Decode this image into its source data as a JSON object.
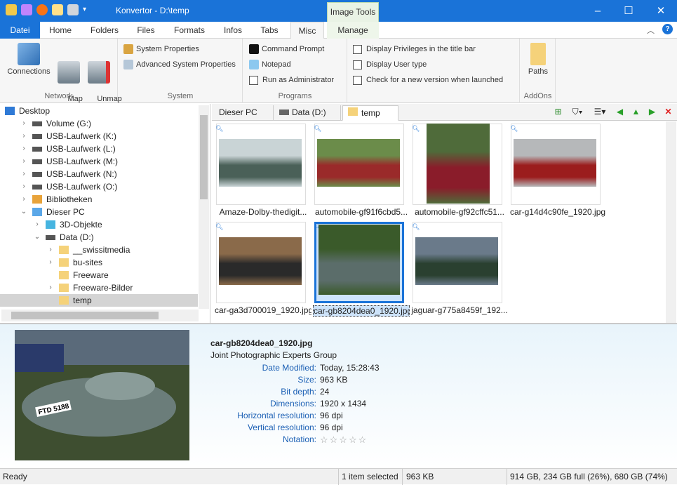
{
  "window": {
    "title": "Konvertor - D:\\temp",
    "context_tab": "Image Tools"
  },
  "tabs": [
    {
      "label": "Datei"
    },
    {
      "label": "Home"
    },
    {
      "label": "Folders"
    },
    {
      "label": "Files"
    },
    {
      "label": "Formats"
    },
    {
      "label": "Infos"
    },
    {
      "label": "Tabs"
    },
    {
      "label": "Misc"
    },
    {
      "label": "Manage"
    }
  ],
  "ribbon": {
    "network": {
      "label": "Network",
      "connections": "Connections",
      "map_drive": "Map\nDrive",
      "unmap_drive": "Unmap\nDrive"
    },
    "system": {
      "label": "System",
      "sys_props": "System Properties",
      "adv_sys_props": "Advanced System Properties"
    },
    "programs": {
      "label": "Programs",
      "cmd": "Command Prompt",
      "notepad": "Notepad",
      "run_admin": "Run as Administrator"
    },
    "options": {
      "privileges": "Display Privileges in the title bar",
      "user_type": "Display User type",
      "check_version": "Check for a new version when launched"
    },
    "addons": {
      "label": "AddOns",
      "paths": "Paths"
    }
  },
  "tree": [
    {
      "label": "Desktop",
      "level": 0,
      "arrow": ""
    },
    {
      "label": "Volume (G:)",
      "level": 1,
      "arrow": ">"
    },
    {
      "label": "USB-Laufwerk (K:)",
      "level": 1,
      "arrow": ">"
    },
    {
      "label": "USB-Laufwerk (L:)",
      "level": 1,
      "arrow": ">"
    },
    {
      "label": "USB-Laufwerk (M:)",
      "level": 1,
      "arrow": ">"
    },
    {
      "label": "USB-Laufwerk (N:)",
      "level": 1,
      "arrow": ">"
    },
    {
      "label": "USB-Laufwerk (O:)",
      "level": 1,
      "arrow": ">"
    },
    {
      "label": "Bibliotheken",
      "level": 1,
      "arrow": ">"
    },
    {
      "label": "Dieser PC",
      "level": 1,
      "arrow": "v"
    },
    {
      "label": "3D-Objekte",
      "level": 2,
      "arrow": ">"
    },
    {
      "label": "Data (D:)",
      "level": 2,
      "arrow": "v"
    },
    {
      "label": "__swissitmedia",
      "level": 3,
      "arrow": ">"
    },
    {
      "label": "bu-sites",
      "level": 3,
      "arrow": ">"
    },
    {
      "label": "Freeware",
      "level": 3,
      "arrow": ""
    },
    {
      "label": "Freeware-Bilder",
      "level": 3,
      "arrow": ">"
    },
    {
      "label": "temp",
      "level": 3,
      "arrow": "",
      "selected": true
    }
  ],
  "path_tabs": [
    {
      "label": "Dieser PC"
    },
    {
      "label": "Data (D:)"
    },
    {
      "label": "temp"
    }
  ],
  "files": [
    {
      "name": "Amaze-Dolby-thedigit...",
      "c1": "#4a6058",
      "c2": "#c9d4d6"
    },
    {
      "name": "automobile-gf91f6cbd5...",
      "c1": "#9a2a2a",
      "c2": "#6b8c4a"
    },
    {
      "name": "automobile-gf92cffc51...",
      "c1": "#8a1c2a",
      "c2": "#4f6b3a"
    },
    {
      "name": "car-g14d4c90fe_1920.jpg",
      "c1": "#9b1d1d",
      "c2": "#b6b8ba"
    },
    {
      "name": "car-ga3d700019_1920.jpg",
      "c1": "#2a2a2a",
      "c2": "#8a6a4a"
    },
    {
      "name": "car-gb8204dea0_1920.jpg",
      "c1": "#5b6d6a",
      "c2": "#3a5a2a",
      "selected": true
    },
    {
      "name": "jaguar-g775a8459f_192...",
      "c1": "#2a4030",
      "c2": "#6a7a8a"
    }
  ],
  "preview": {
    "filename": "car-gb8204dea0_1920.jpg",
    "type": "Joint Photographic Experts Group",
    "props": [
      {
        "k": "Date Modified:",
        "v": "Today, 15:28:43"
      },
      {
        "k": "Size:",
        "v": "963 KB"
      },
      {
        "k": "Bit depth:",
        "v": "24"
      },
      {
        "k": "Dimensions:",
        "v": "1920 x 1434"
      },
      {
        "k": "Horizontal resolution:",
        "v": "96 dpi"
      },
      {
        "k": "Vertical resolution:",
        "v": "96 dpi"
      },
      {
        "k": "Notation:",
        "v": "☆☆☆☆☆"
      }
    ],
    "plate": "FTD 5188"
  },
  "status": {
    "ready": "Ready",
    "selected": "1 item selected",
    "size": "963 KB",
    "disk": "914 GB,  234 GB full (26%),  680 GB  (74%)"
  },
  "colors": {
    "accent": "#1a73d8",
    "label_blue": "#1a5fb4"
  }
}
